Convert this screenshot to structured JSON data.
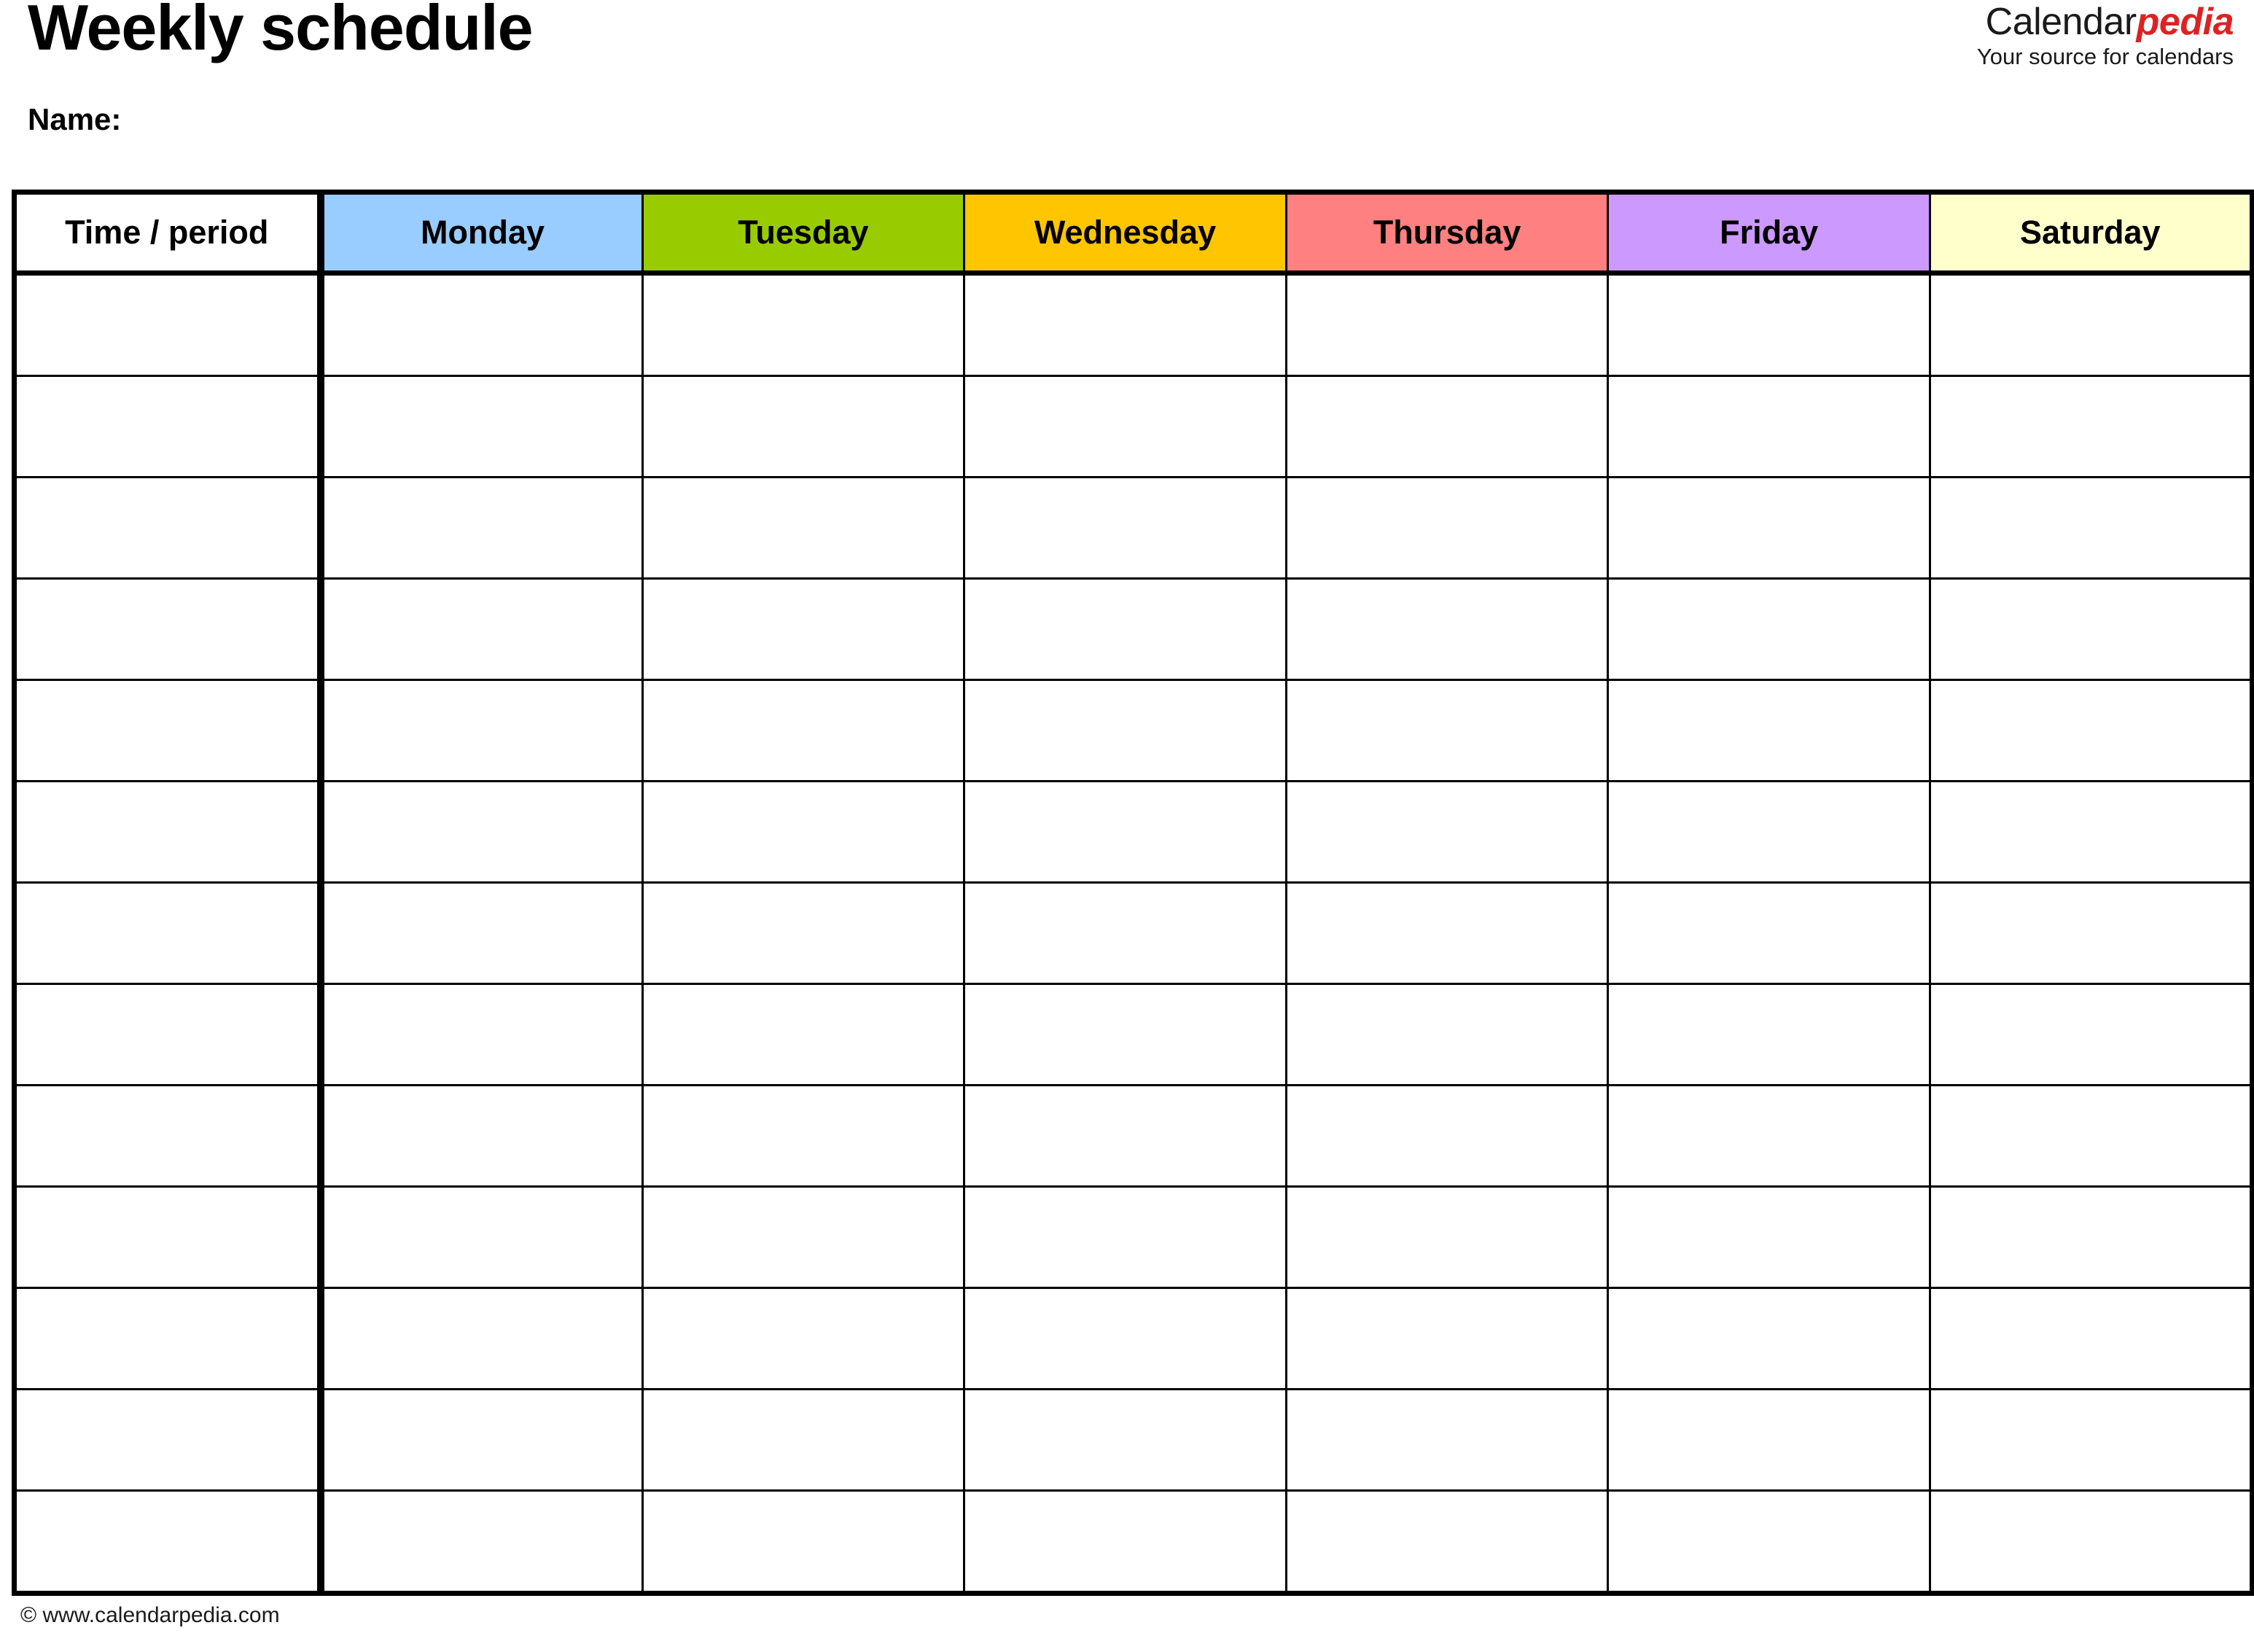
{
  "document": {
    "title": "Weekly schedule",
    "name_label": "Name:"
  },
  "brand": {
    "part1": "Calendar",
    "part2": "pedia",
    "tagline": "Your source for calendars",
    "accent_color": "#DD2222",
    "text_color": "#1A1A1A"
  },
  "table": {
    "columns": [
      {
        "label": "Time / period",
        "color": "#FFFFFF",
        "key": "time"
      },
      {
        "label": "Monday",
        "color": "#99CCFF",
        "key": "monday"
      },
      {
        "label": "Tuesday",
        "color": "#99CC00",
        "key": "tuesday"
      },
      {
        "label": "Wednesday",
        "color": "#FFC600",
        "key": "wednesday"
      },
      {
        "label": "Thursday",
        "color": "#FF8080",
        "key": "thursday"
      },
      {
        "label": "Friday",
        "color": "#CC99FF",
        "key": "friday"
      },
      {
        "label": "Saturday",
        "color": "#FFFFCC",
        "key": "saturday"
      }
    ],
    "row_count": 13,
    "rows": [
      {
        "time": "",
        "monday": "",
        "tuesday": "",
        "wednesday": "",
        "thursday": "",
        "friday": "",
        "saturday": ""
      },
      {
        "time": "",
        "monday": "",
        "tuesday": "",
        "wednesday": "",
        "thursday": "",
        "friday": "",
        "saturday": ""
      },
      {
        "time": "",
        "monday": "",
        "tuesday": "",
        "wednesday": "",
        "thursday": "",
        "friday": "",
        "saturday": ""
      },
      {
        "time": "",
        "monday": "",
        "tuesday": "",
        "wednesday": "",
        "thursday": "",
        "friday": "",
        "saturday": ""
      },
      {
        "time": "",
        "monday": "",
        "tuesday": "",
        "wednesday": "",
        "thursday": "",
        "friday": "",
        "saturday": ""
      },
      {
        "time": "",
        "monday": "",
        "tuesday": "",
        "wednesday": "",
        "thursday": "",
        "friday": "",
        "saturday": ""
      },
      {
        "time": "",
        "monday": "",
        "tuesday": "",
        "wednesday": "",
        "thursday": "",
        "friday": "",
        "saturday": ""
      },
      {
        "time": "",
        "monday": "",
        "tuesday": "",
        "wednesday": "",
        "thursday": "",
        "friday": "",
        "saturday": ""
      },
      {
        "time": "",
        "monday": "",
        "tuesday": "",
        "wednesday": "",
        "thursday": "",
        "friday": "",
        "saturday": ""
      },
      {
        "time": "",
        "monday": "",
        "tuesday": "",
        "wednesday": "",
        "thursday": "",
        "friday": "",
        "saturday": ""
      },
      {
        "time": "",
        "monday": "",
        "tuesday": "",
        "wednesday": "",
        "thursday": "",
        "friday": "",
        "saturday": ""
      },
      {
        "time": "",
        "monday": "",
        "tuesday": "",
        "wednesday": "",
        "thursday": "",
        "friday": "",
        "saturday": ""
      },
      {
        "time": "",
        "monday": "",
        "tuesday": "",
        "wednesday": "",
        "thursday": "",
        "friday": "",
        "saturday": ""
      }
    ]
  },
  "footer": {
    "copyright": "© www.calendarpedia.com"
  }
}
